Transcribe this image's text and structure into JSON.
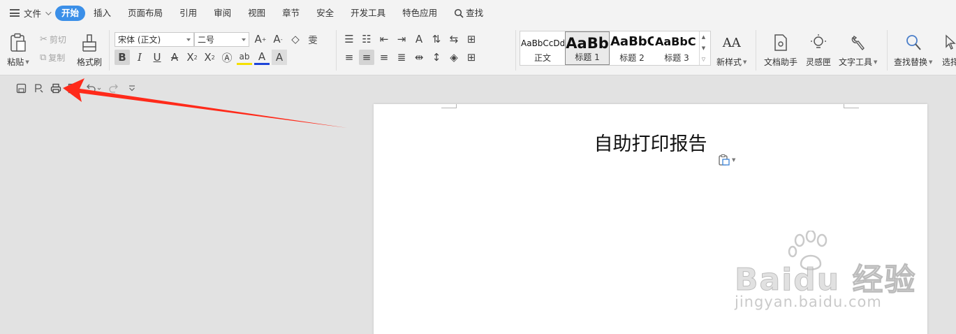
{
  "menubar": {
    "file_label": "文件",
    "tabs": [
      "开始",
      "插入",
      "页面布局",
      "引用",
      "审阅",
      "视图",
      "章节",
      "安全",
      "开发工具",
      "特色应用",
      "查找"
    ]
  },
  "ribbon": {
    "paste_label": "粘贴",
    "cut_label": "剪切",
    "copy_label": "复制",
    "format_painter_label": "格式刷",
    "font_name": "宋体 (正文)",
    "font_size": "二号",
    "styles": [
      {
        "sample": "AaBbCcDd",
        "name": "正文"
      },
      {
        "sample": "AaBb",
        "name": "标题 1"
      },
      {
        "sample": "AaBbC",
        "name": "标题 2"
      },
      {
        "sample": "AaBbC",
        "name": "标题 3"
      }
    ],
    "new_style_label": "新样式",
    "doc_assistant_label": "文档助手",
    "inspiration_label": "灵感匣",
    "text_tools_label": "文字工具",
    "find_replace_label": "查找替换",
    "select_label": "选择"
  },
  "document": {
    "title": "自助打印报告"
  },
  "watermark": {
    "main": "Baidu 经验",
    "sub": "jingyan.baidu.com"
  },
  "annotation": {
    "arrow_color": "#ff2a1a"
  }
}
